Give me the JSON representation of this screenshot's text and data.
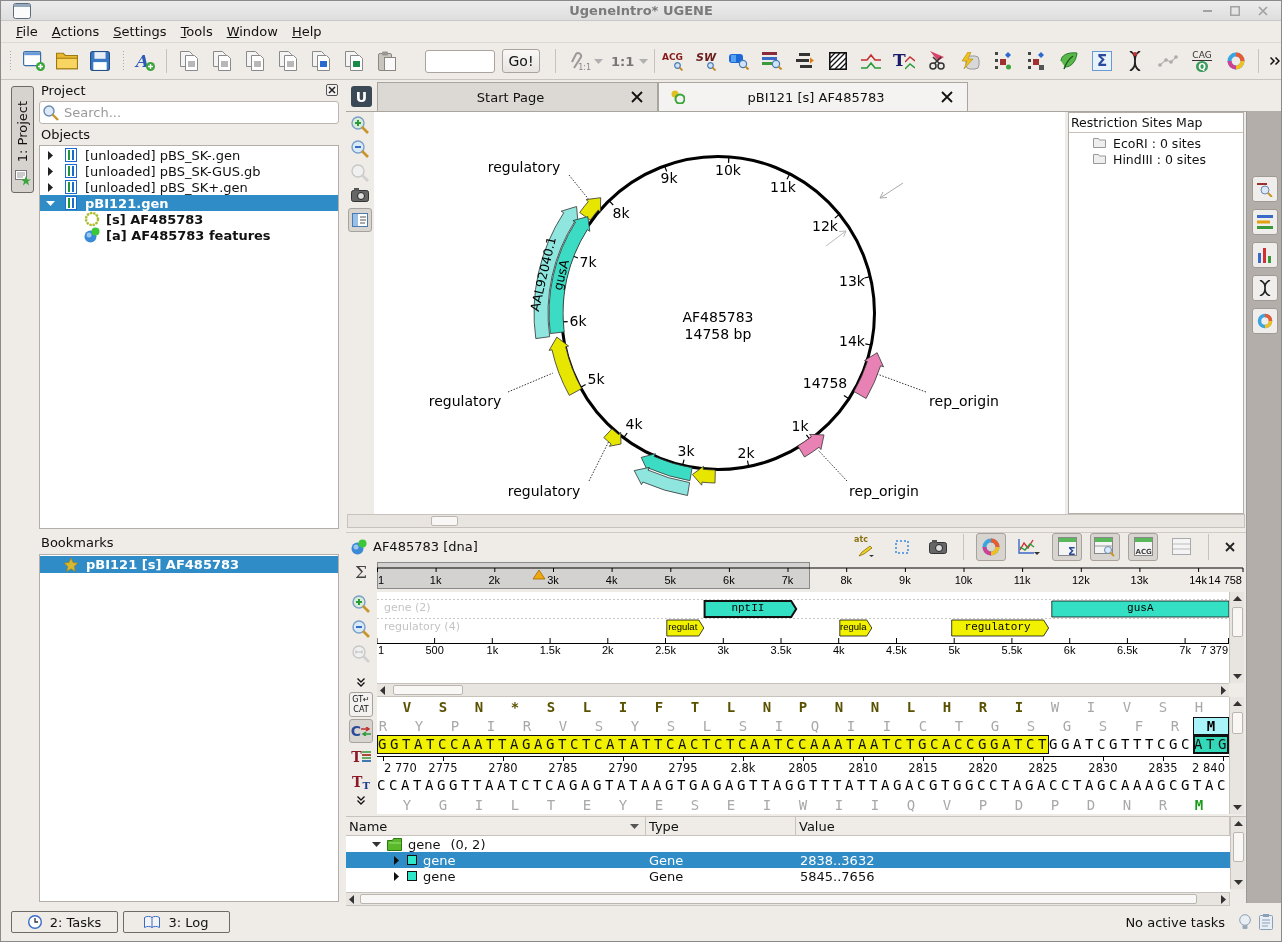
{
  "window": {
    "title": "UgeneIntro* UGENE"
  },
  "menu": [
    "File",
    "Actions",
    "Settings",
    "Tools",
    "Window",
    "Help"
  ],
  "toolbar": {
    "add_glyph": "A",
    "go_button": "Go!",
    "pin_scale": "1:1",
    "zoom_scale": "1:1",
    "search_glyphs": [
      "ACG",
      "SW"
    ],
    "edit_glyph": "T",
    "sum_glyph": "Σ",
    "query_glyphs": [
      "CAG",
      "Q"
    ]
  },
  "side_tabs": [
    {
      "label": "1: Project",
      "selected": true
    }
  ],
  "project": {
    "title": "Project",
    "search": {
      "placeholder": "Search..."
    },
    "objects_label": "Objects",
    "tree": [
      {
        "label": "[unloaded] pBS_SK-.gen",
        "expanded": false,
        "selected": false
      },
      {
        "label": "[unloaded] pBS_SK-GUS.gb",
        "expanded": false,
        "selected": false
      },
      {
        "label": "[unloaded] pBS_SK+.gen",
        "expanded": false,
        "selected": false
      },
      {
        "label": "pBI121.gen",
        "expanded": true,
        "selected": true,
        "children": [
          {
            "label": "[s] AF485783",
            "kind": "sequence",
            "selected": false
          },
          {
            "label": "[a] AF485783 features",
            "kind": "annotations",
            "selected": false
          }
        ]
      }
    ]
  },
  "bookmarks": {
    "title": "Bookmarks",
    "items": [
      {
        "label": "pBI121 [s] AF485783",
        "selected": true
      }
    ]
  },
  "editor": {
    "logo": "U",
    "tabs": [
      {
        "label": "Start Page",
        "selected": false
      },
      {
        "label": "pBI121 [s] AF485783",
        "selected": true
      }
    ]
  },
  "circular_view": {
    "panel_button": {
      "pressed": true
    },
    "name": "AF485783",
    "length": "14758 bp",
    "ticks": [
      "9k",
      "10k",
      "11k",
      "12k",
      "13k",
      "14k",
      "14758",
      "1k",
      "2k",
      "3k",
      "4k",
      "5k",
      "6k",
      "7k",
      "8k"
    ],
    "features": [
      {
        "label": "regulatory",
        "color": "#e6e600"
      },
      {
        "label": "AAL92040.1",
        "color": "#8fe6de"
      },
      {
        "label": "gusA",
        "color": "#3cdcc4"
      },
      {
        "label": "regulatory",
        "color": "#e6e600"
      },
      {
        "label": "regulatory",
        "color": "#e6e600"
      },
      {
        "color": "#e6e600"
      },
      {
        "color": "#3cdcc4"
      },
      {
        "color": "#8fe6de"
      },
      {
        "label": "rep_origin",
        "color": "#e882b4"
      },
      {
        "label": "rep_origin",
        "color": "#e882b4"
      }
    ]
  },
  "restriction_map": {
    "title": "Restriction Sites Map",
    "items": [
      "EcoRI : 0 sites",
      "HindIII : 0 sites"
    ]
  },
  "sequence_view": {
    "title": "AF485783 [dna]",
    "edit_glyph": "atc",
    "panel_glyphs": [
      "Σ",
      "ACG"
    ],
    "toggles": [
      {
        "pressed": true
      },
      {
        "pressed": false
      },
      {
        "pressed": true
      },
      {
        "pressed": true
      },
      {
        "pressed": true
      },
      {
        "pressed": false
      }
    ],
    "side_tools": {
      "sum_glyph": "Σ",
      "wrap_glyphs": [
        "GT↵",
        "CAT"
      ],
      "complement_glyph": "C",
      "text_glyphs": [
        "T",
        "T",
        "T"
      ],
      "toggles": [
        {
          "pressed": false
        },
        {
          "pressed": true
        }
      ]
    },
    "overview_ticks": [
      "1",
      "1k",
      "2k",
      "3k",
      "4k",
      "5k",
      "6k",
      "7k",
      "8k",
      "9k",
      "10k",
      "11k",
      "12k",
      "13k",
      "14k",
      "14 758"
    ],
    "tracks": [
      {
        "label": "gene (2)",
        "color": "#33e0c4",
        "features": [
          {
            "label": "nptII",
            "selected": true
          },
          {
            "label": "gusA",
            "selected": false
          }
        ]
      },
      {
        "label": "regulatory (4)",
        "color": "#f2f200",
        "features": [
          {
            "label": "regulat",
            "selected": false
          },
          {
            "label": "regula",
            "selected": false
          },
          {
            "label": "regulatory",
            "selected": false
          }
        ]
      }
    ],
    "ruler_ticks": [
      "1",
      "500",
      "1k",
      "1.5k",
      "2k",
      "2.5k",
      "3k",
      "3.5k",
      "4k",
      "4.5k",
      "5k",
      "5.5k",
      "6k",
      "6.5k",
      "7k",
      "7 379"
    ],
    "frames_top": [
      [
        {
          "text": "V S N * S L I F T L N P N N L H R I",
          "kind": "annotated"
        },
        {
          "text": "W I V S H",
          "kind": "plain"
        }
      ],
      [
        {
          "text": "R Y P I R V S Y S L S I Q I I C T G S G S F R",
          "kind": "plain"
        },
        {
          "text": "M",
          "kind": "start_selected"
        }
      ]
    ],
    "strand": [
      {
        "text": "GGTATCCAATTAGAGTCTCATATTCACTCTCAATCCAAATAATCTGCACCGGATCT",
        "kind": "regulatory"
      },
      {
        "text": "GGATCGTTTCGC",
        "kind": "plain"
      },
      {
        "text": "ATG",
        "kind": "gene"
      }
    ],
    "positions": [
      "2 770",
      "2775",
      "2780",
      "2785",
      "2790",
      "2795",
      "2.8k",
      "2805",
      "2810",
      "2815",
      "2820",
      "2825",
      "2830",
      "2835",
      "2 840"
    ],
    "complement": "CCATAGGTTAATCTCAGAGTATAAGTGAGAGTTAGGTTTATTAGACGTGGCCTAGACCTAGCAAAGCGTAC",
    "frames_bottom": [
      [
        {
          "text": "Y G I L T E Y E S E I W I I Q V P D P D N R",
          "kind": "plain"
        },
        {
          "text": "M",
          "kind": "start"
        }
      ]
    ]
  },
  "annotations": {
    "columns": [
      "Name",
      "Type",
      "Value"
    ],
    "groups": [
      {
        "name": "gene",
        "count": "(0, 2)",
        "expanded": true,
        "children": [
          {
            "name": "gene",
            "type": "Gene",
            "value": "2838..3632",
            "selected": true,
            "expanded": false,
            "color": "#2ee6c8"
          },
          {
            "name": "gene",
            "type": "Gene",
            "value": "5845..7656",
            "selected": false,
            "expanded": false,
            "color": "#2ee6c8"
          }
        ]
      }
    ]
  },
  "status_bar": {
    "buttons": [
      "2: Tasks",
      "3: Log"
    ],
    "message": "No active tasks"
  }
}
